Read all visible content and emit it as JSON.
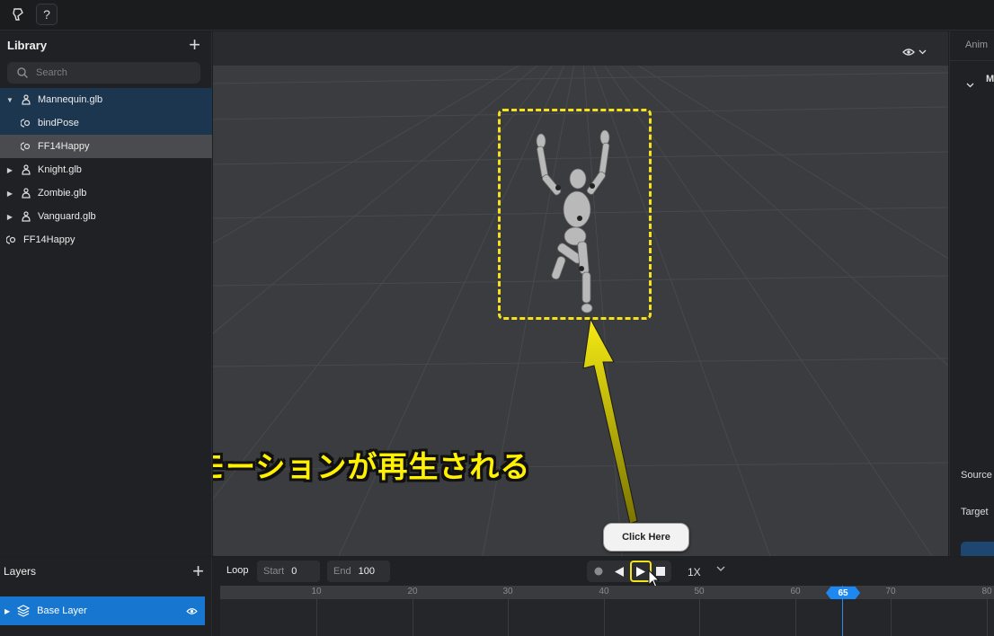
{
  "topbar": {
    "logo_icon": "brush-logo-icon",
    "help_label": "?"
  },
  "library": {
    "title": "Library",
    "add_label": "+",
    "search_placeholder": "Search",
    "items": [
      {
        "label": "Mannequin.glb",
        "type": "model",
        "expanded": true,
        "selected": true,
        "indent": 0
      },
      {
        "label": "bindPose",
        "type": "animation",
        "indent": 1,
        "selected": true
      },
      {
        "label": "FF14Happy",
        "type": "animation",
        "indent": 1,
        "highlighted": true
      },
      {
        "label": "Knight.glb",
        "type": "model",
        "indent": 0
      },
      {
        "label": "Zombie.glb",
        "type": "model",
        "indent": 0
      },
      {
        "label": "Vanguard.glb",
        "type": "model",
        "indent": 0
      },
      {
        "label": "FF14Happy",
        "type": "animation",
        "indent": -1
      }
    ]
  },
  "viewport": {
    "view_toggle_icon": "eye-icon",
    "caption": "モーションが再生される",
    "callout": "Click Here"
  },
  "right_panel": {
    "tab": "Anim",
    "section": "M",
    "source_label": "Source",
    "target_label": "Target"
  },
  "layers": {
    "title": "Layers",
    "add_label": "+",
    "base_layer": "Base Layer"
  },
  "timeline": {
    "loop_label": "Loop",
    "start_label": "Start",
    "start_value": "0",
    "end_label": "End",
    "end_value": "100",
    "speed": "1X",
    "ticks": [
      "10",
      "20",
      "30",
      "40",
      "50",
      "60",
      "70",
      "80"
    ],
    "current_frame": "65"
  },
  "colors": {
    "accent": "#1776d0",
    "highlight": "#f5e21a",
    "selection": "#1d3650"
  }
}
